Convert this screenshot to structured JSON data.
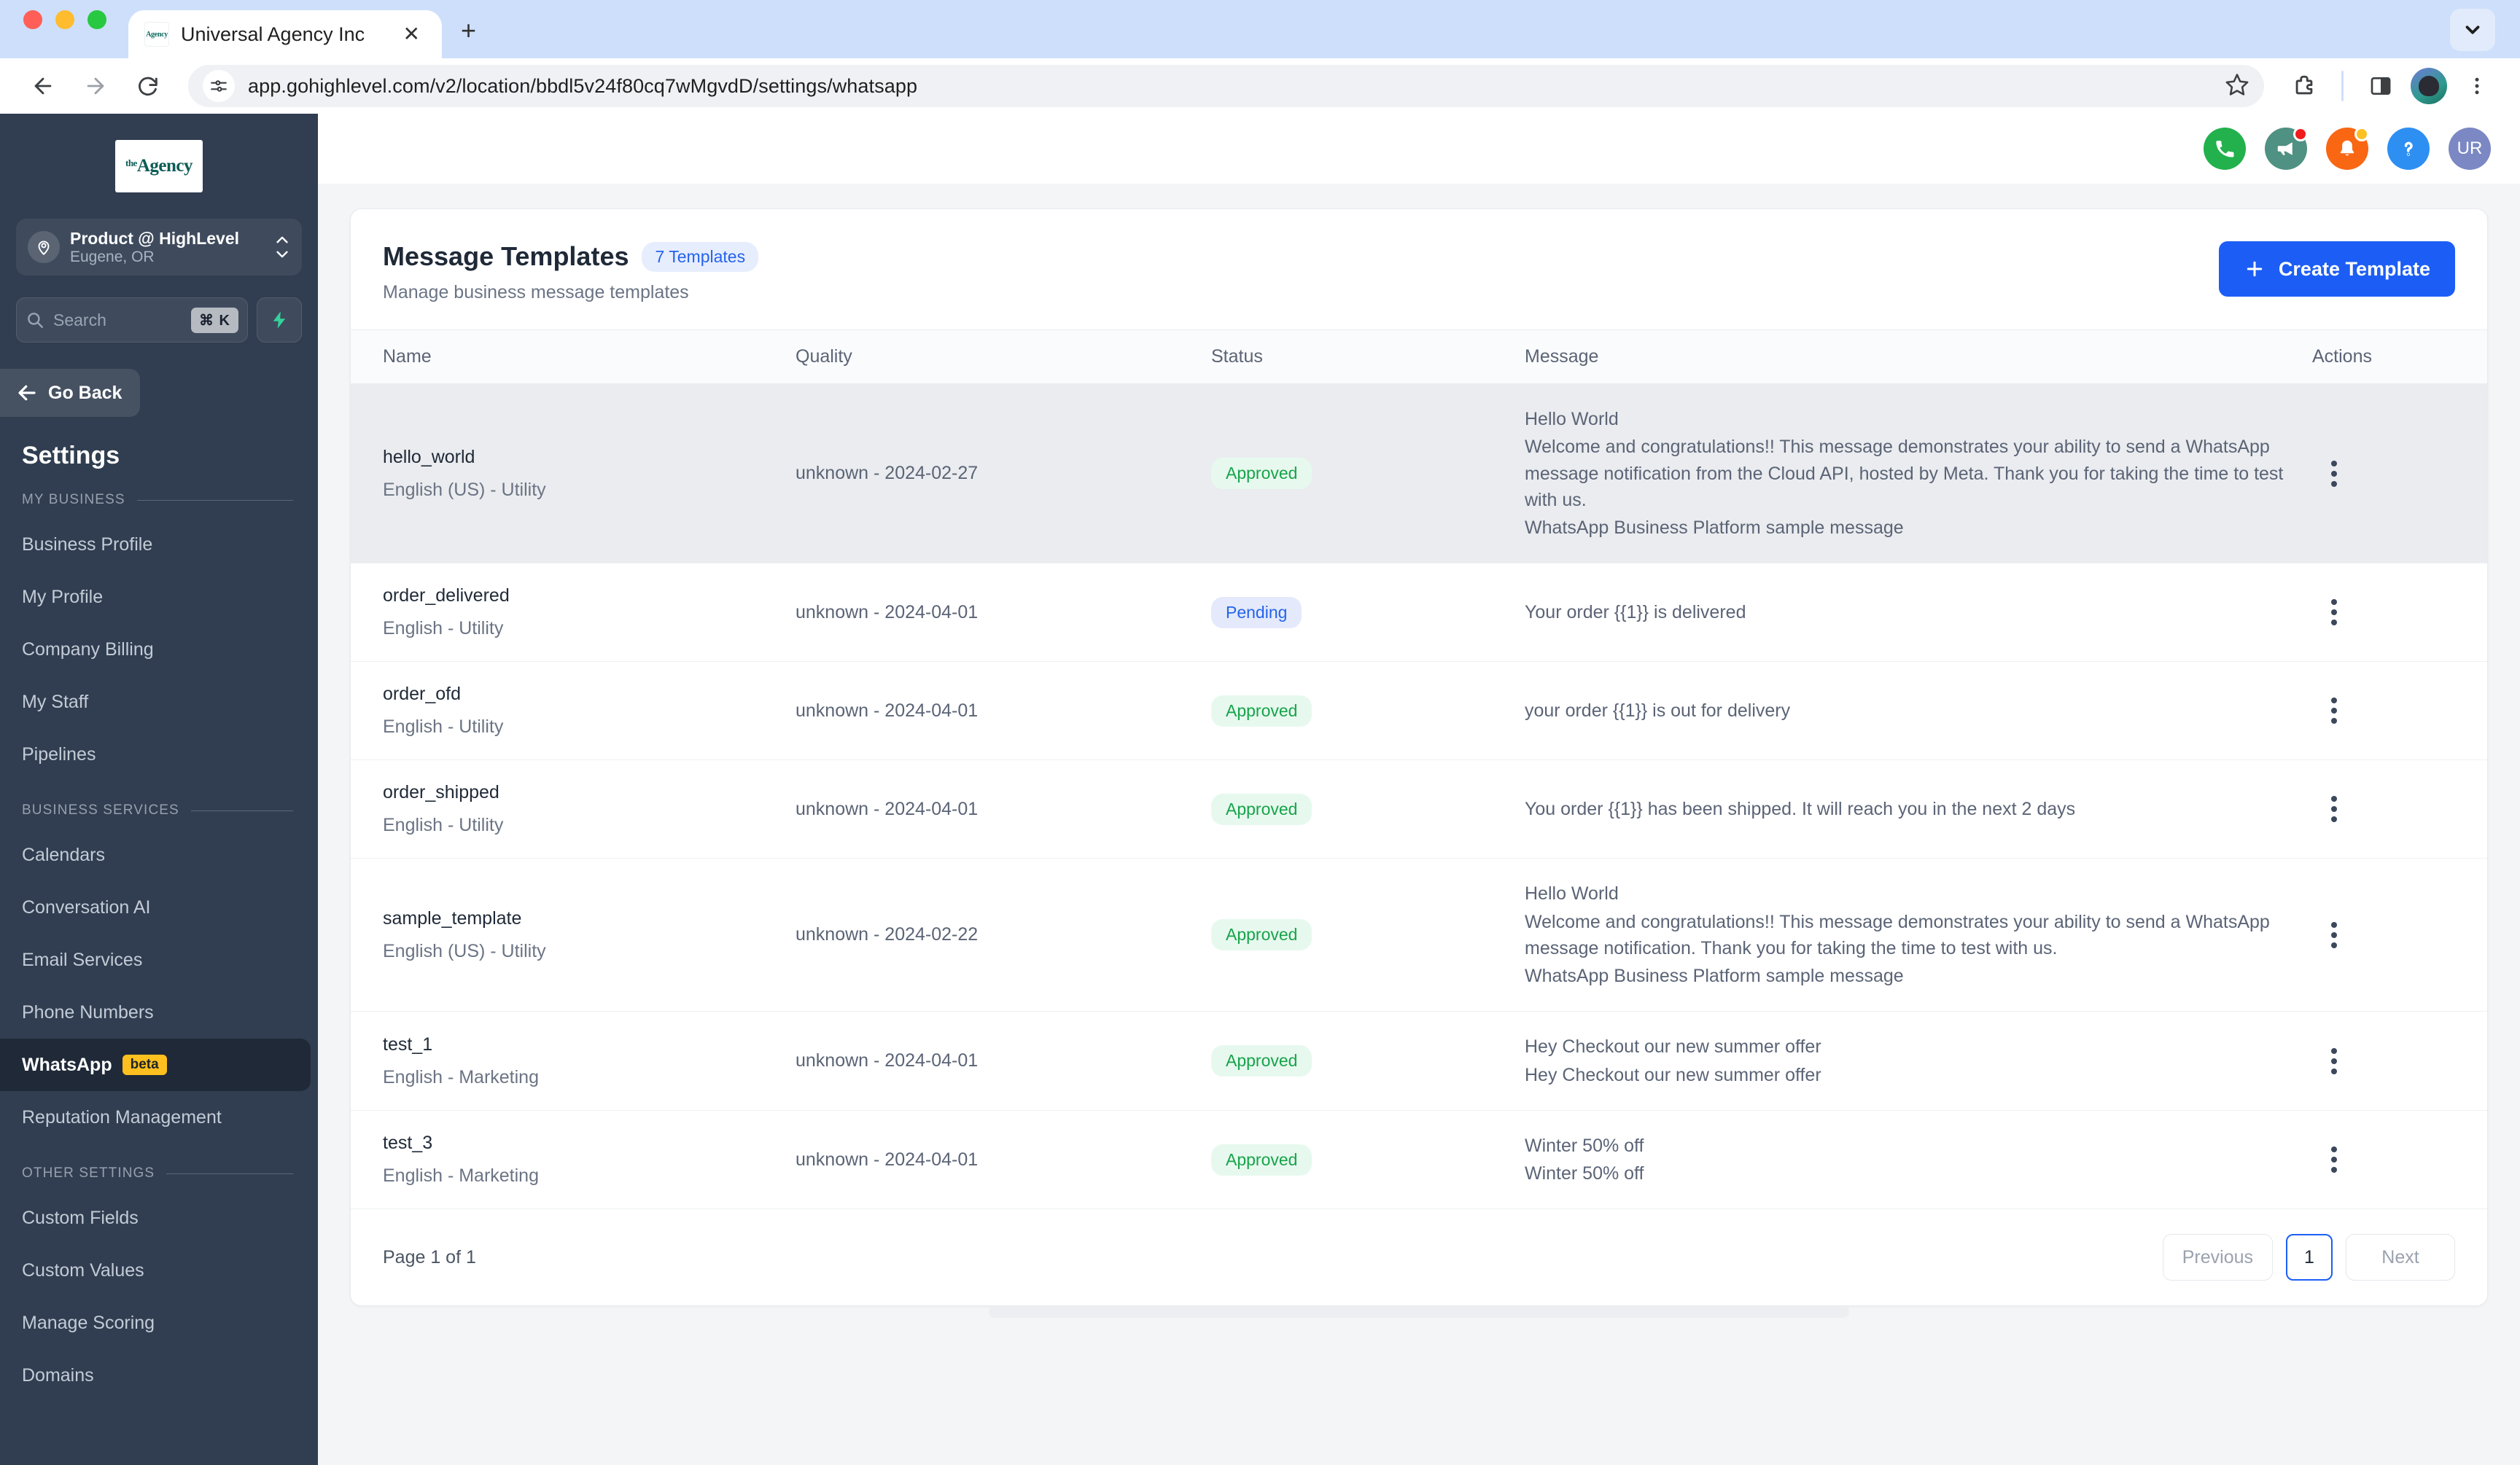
{
  "browser": {
    "tab": {
      "title": "Universal Agency Inc",
      "favicon_label": "Agency",
      "close_label": "✕"
    },
    "new_tab_label": "+",
    "url": "app.gohighlevel.com/v2/location/bbdl5v24f80cq7wMgvdD/settings/whatsapp"
  },
  "sidebar": {
    "logo": {
      "sup": "the",
      "name": "Agency"
    },
    "location": {
      "name": "Product @ HighLevel",
      "sub": "Eugene, OR"
    },
    "search": {
      "placeholder": "Search",
      "shortcut": "⌘ K"
    },
    "go_back": "Go Back",
    "settings_title": "Settings",
    "sections": [
      {
        "label": "MY BUSINESS",
        "items": [
          {
            "label": "Business Profile",
            "active": false
          },
          {
            "label": "My Profile",
            "active": false
          },
          {
            "label": "Company Billing",
            "active": false
          },
          {
            "label": "My Staff",
            "active": false
          },
          {
            "label": "Pipelines",
            "active": false
          }
        ]
      },
      {
        "label": "BUSINESS SERVICES",
        "items": [
          {
            "label": "Calendars",
            "active": false
          },
          {
            "label": "Conversation AI",
            "active": false
          },
          {
            "label": "Email Services",
            "active": false
          },
          {
            "label": "Phone Numbers",
            "active": false
          },
          {
            "label": "WhatsApp",
            "active": true,
            "badge": "beta"
          },
          {
            "label": "Reputation Management",
            "active": false
          }
        ]
      },
      {
        "label": "OTHER SETTINGS",
        "items": [
          {
            "label": "Custom Fields",
            "active": false
          },
          {
            "label": "Custom Values",
            "active": false
          },
          {
            "label": "Manage Scoring",
            "active": false
          },
          {
            "label": "Domains",
            "active": false
          }
        ]
      }
    ]
  },
  "topbar": {
    "icons": [
      "phone-icon",
      "megaphone-icon",
      "bell-icon",
      "help-icon"
    ],
    "user_initials": "UR"
  },
  "page": {
    "title": "Message Templates",
    "count_pill": "7 Templates",
    "subtitle": "Manage business message templates",
    "create_button": "Create Template",
    "columns": [
      "Name",
      "Quality",
      "Status",
      "Message",
      "Actions"
    ],
    "rows": [
      {
        "name": "hello_world",
        "lang": "English (US) - Utility",
        "quality": "unknown - 2024-02-27",
        "status": "Approved",
        "status_kind": "approved",
        "message": [
          "Hello World",
          "Welcome and congratulations!! This message demonstrates your ability to send a WhatsApp message notification from the Cloud API, hosted by Meta. Thank you for taking the time to test with us.",
          "WhatsApp Business Platform sample message"
        ],
        "highlight": true
      },
      {
        "name": "order_delivered",
        "lang": "English - Utility",
        "quality": "unknown - 2024-04-01",
        "status": "Pending",
        "status_kind": "pending",
        "message": [
          "Your order {{1}} is delivered"
        ],
        "highlight": false
      },
      {
        "name": "order_ofd",
        "lang": "English - Utility",
        "quality": "unknown - 2024-04-01",
        "status": "Approved",
        "status_kind": "approved",
        "message": [
          "your order {{1}} is out for delivery"
        ],
        "highlight": false
      },
      {
        "name": "order_shipped",
        "lang": "English - Utility",
        "quality": "unknown - 2024-04-01",
        "status": "Approved",
        "status_kind": "approved",
        "message": [
          "You order {{1}} has been shipped. It will reach you in the next 2 days"
        ],
        "highlight": false
      },
      {
        "name": "sample_template",
        "lang": "English (US) - Utility",
        "quality": "unknown - 2024-02-22",
        "status": "Approved",
        "status_kind": "approved",
        "message": [
          "Hello World",
          "Welcome and congratulations!! This message demonstrates your ability to send a WhatsApp message notification. Thank you for taking the time to test with us.",
          "WhatsApp Business Platform sample message"
        ],
        "highlight": false
      },
      {
        "name": "test_1",
        "lang": "English - Marketing",
        "quality": "unknown - 2024-04-01",
        "status": "Approved",
        "status_kind": "approved",
        "message": [
          "Hey Checkout our new summer offer",
          "Hey Checkout our new summer offer"
        ],
        "highlight": false
      },
      {
        "name": "test_3",
        "lang": "English - Marketing",
        "quality": "unknown - 2024-04-01",
        "status": "Approved",
        "status_kind": "approved",
        "message": [
          "Winter 50% off",
          "Winter 50% off"
        ],
        "highlight": false
      }
    ],
    "footer": {
      "page_label": "Page 1 of 1",
      "previous": "Previous",
      "current_page": "1",
      "next": "Next"
    }
  },
  "colors": {
    "accent_blue": "#1c5ef5",
    "sidebar_bg": "#313e51",
    "approved_green": "#16a34a",
    "pending_blue": "#2563eb",
    "beta_yellow": "#fec01e"
  }
}
